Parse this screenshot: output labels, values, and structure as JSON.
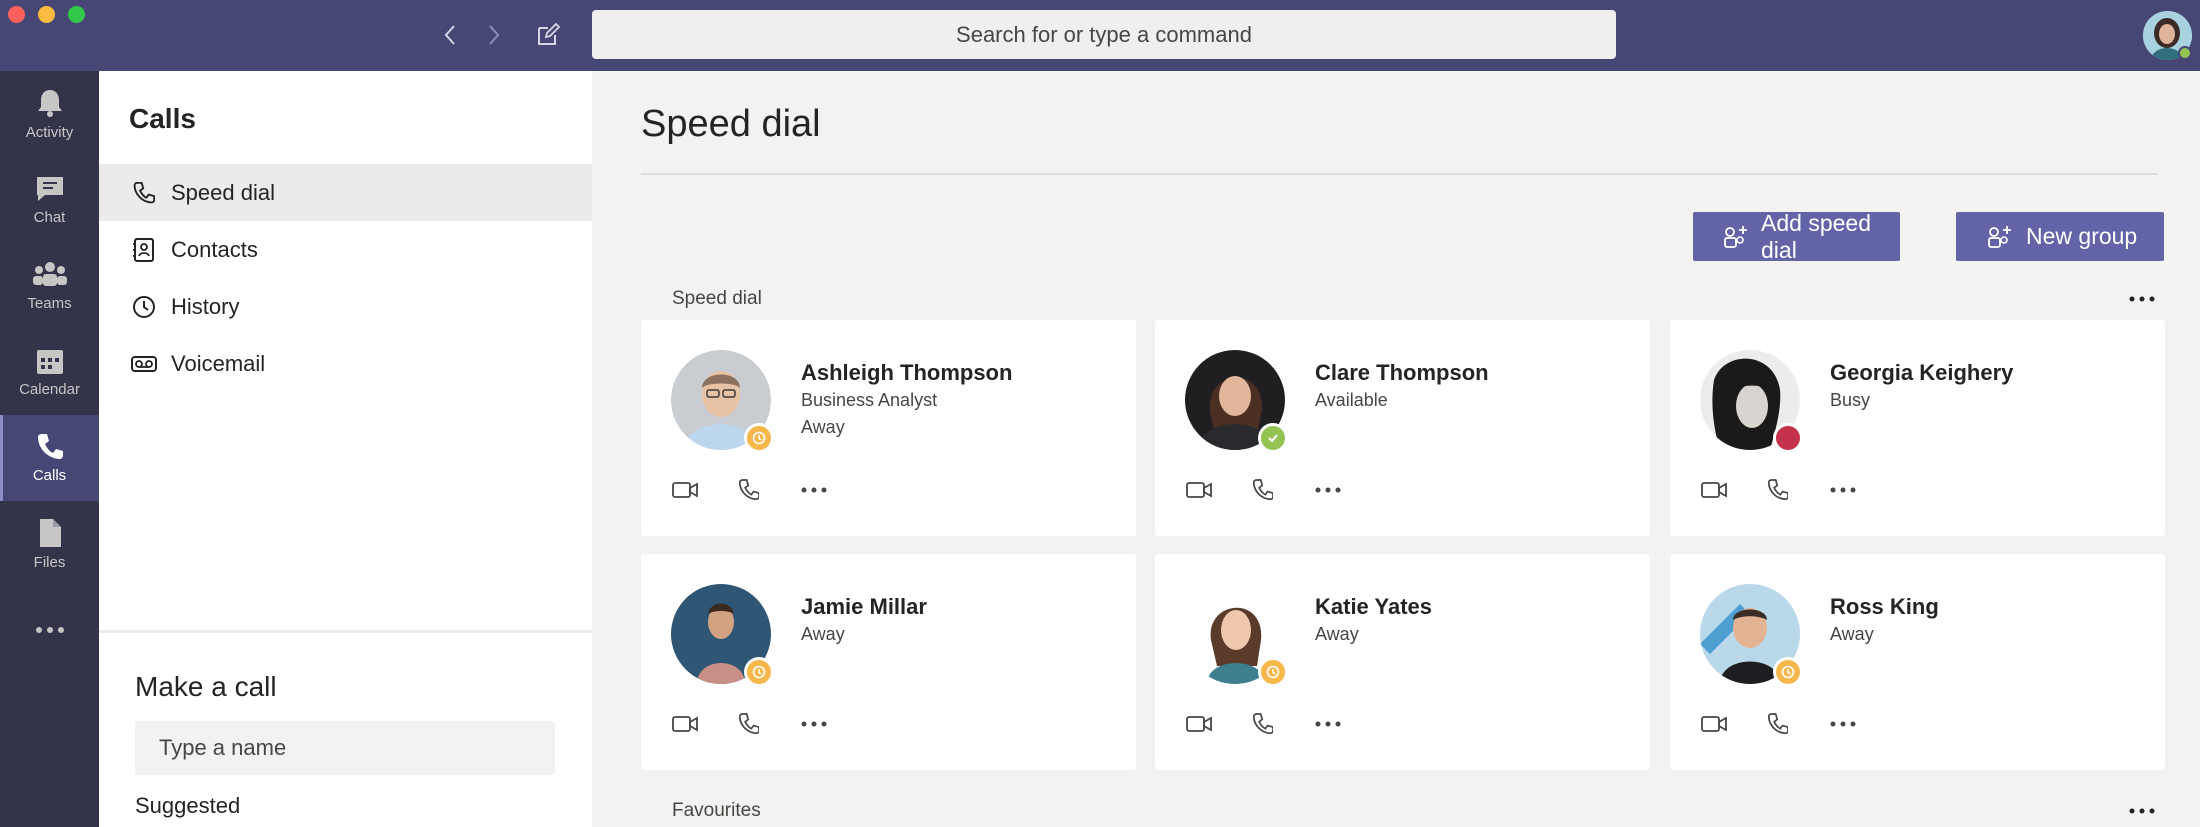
{
  "search": {
    "placeholder": "Search for or type a command"
  },
  "rail": {
    "items": [
      {
        "label": "Activity"
      },
      {
        "label": "Chat"
      },
      {
        "label": "Teams"
      },
      {
        "label": "Calendar"
      },
      {
        "label": "Calls",
        "active": true
      },
      {
        "label": "Files"
      }
    ]
  },
  "left_panel": {
    "title": "Calls",
    "items": [
      {
        "label": "Speed dial",
        "active": true
      },
      {
        "label": "Contacts"
      },
      {
        "label": "History"
      },
      {
        "label": "Voicemail"
      }
    ],
    "make_call": {
      "title": "Make a call",
      "input_placeholder": "Type a name",
      "suggested_label": "Suggested"
    }
  },
  "main": {
    "title": "Speed dial",
    "add_speed_dial_label": "Add speed dial",
    "new_group_label": "New group",
    "section_speed_dial": "Speed dial",
    "section_favourites": "Favourites",
    "contacts": [
      {
        "name": "Ashleigh Thompson",
        "line1": "Business Analyst",
        "line2": "Away",
        "presence": "away"
      },
      {
        "name": "Clare Thompson",
        "line1": "Available",
        "line2": "",
        "presence": "available"
      },
      {
        "name": "Georgia Keighery",
        "line1": "Busy",
        "line2": "",
        "presence": "busy"
      },
      {
        "name": "Jamie Millar",
        "line1": "Away",
        "line2": "",
        "presence": "away"
      },
      {
        "name": "Katie Yates",
        "line1": "Away",
        "line2": "",
        "presence": "away"
      },
      {
        "name": "Ross King",
        "line1": "Away",
        "line2": "",
        "presence": "away"
      }
    ]
  },
  "colors": {
    "brand": "#464775",
    "rail": "#33344a",
    "button": "#6264a7",
    "away": "#f8b74a",
    "available": "#92c353",
    "busy": "#c4314b"
  },
  "icons": {
    "rail": [
      "bell-icon",
      "chat-icon",
      "teams-icon",
      "calendar-icon",
      "phone-icon",
      "file-icon",
      "more-icon"
    ],
    "left_panel": [
      "phone-icon",
      "contact-card-icon",
      "clock-icon",
      "voicemail-icon"
    ],
    "card_actions": [
      "video-icon",
      "phone-icon",
      "more-icon"
    ]
  }
}
